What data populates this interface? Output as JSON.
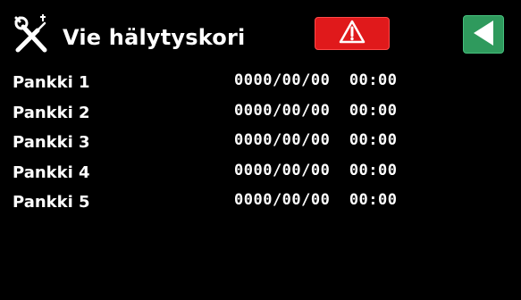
{
  "header": {
    "title": "Vie hälytyskori",
    "tools_icon": "tools-icon",
    "alarm_icon": "warning-icon",
    "back_icon": "back-arrow-icon",
    "alarm_color": "#e0191b",
    "back_color": "#2f9a5d"
  },
  "banks": [
    {
      "label": "Pankki 1",
      "value": "0000/00/00  00:00"
    },
    {
      "label": "Pankki 2",
      "value": "0000/00/00  00:00"
    },
    {
      "label": "Pankki 3",
      "value": "0000/00/00  00:00"
    },
    {
      "label": "Pankki 4",
      "value": "0000/00/00  00:00"
    },
    {
      "label": "Pankki 5",
      "value": "0000/00/00  00:00"
    }
  ]
}
